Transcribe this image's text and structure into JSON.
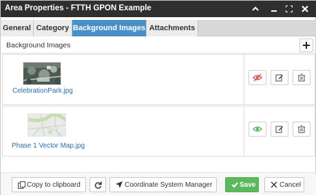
{
  "window": {
    "title": "Area Properties - FTTH GPON Example",
    "controls": [
      "chevron-up-icon",
      "minimize-icon",
      "expand-icon",
      "close-icon"
    ]
  },
  "tabs": [
    {
      "label": "General",
      "active": false
    },
    {
      "label": "Category",
      "active": false
    },
    {
      "label": "Background Images",
      "active": true
    },
    {
      "label": "Attachments",
      "active": false
    }
  ],
  "section": {
    "title": "Background Images",
    "add_icon": "plus-icon"
  },
  "images": [
    {
      "file_name": "CelebrationPark.jpg",
      "thumbnail": "aerial-photo",
      "visible": false,
      "visibility_icon": "eye-slash-icon",
      "visibility_color": "#d9534f"
    },
    {
      "file_name": "Phase 1 Vector Map.jpg",
      "thumbnail": "street-map",
      "visible": true,
      "visibility_icon": "eye-icon",
      "visibility_color": "#5cb85c"
    }
  ],
  "row_actions": [
    "edit-icon",
    "delete-icon"
  ],
  "footer": {
    "copy_label": "Copy to clipboard",
    "refresh_icon": "refresh-icon",
    "coord_label": "Coordinate System Manager",
    "save_label": "Save",
    "cancel_label": "Cancel"
  },
  "colors": {
    "titlebar": "#2f2f2f",
    "active_tab": "#4a90c8",
    "link": "#2a6eaa",
    "save": "#5cb85c"
  }
}
